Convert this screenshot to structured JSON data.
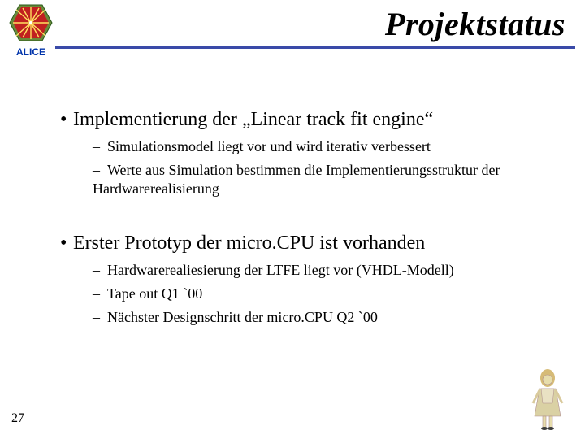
{
  "header": {
    "logo_label": "ALICE",
    "title": "Projektstatus"
  },
  "bullets": [
    {
      "text": "Implementierung der „Linear track fit engine“",
      "subs": [
        "Simulationsmodel liegt vor und wird iterativ verbessert",
        "Werte aus Simulation bestimmen die Implementierungsstruktur der Hardwarerealisierung"
      ]
    },
    {
      "text": "Erster Prototyp der micro.CPU ist vorhanden",
      "subs": [
        "Hardwarerealiesierung der LTFE liegt vor (VHDL-Modell)",
        "Tape out Q1 `00",
        "Nächster Designschritt der micro.CPU Q2 `00"
      ]
    }
  ],
  "page_number": "27",
  "glyphs": {
    "bullet": "•",
    "dash": "–"
  },
  "icons": {
    "logo": "alice-logo-icon",
    "corner": "alice-figure-icon"
  }
}
